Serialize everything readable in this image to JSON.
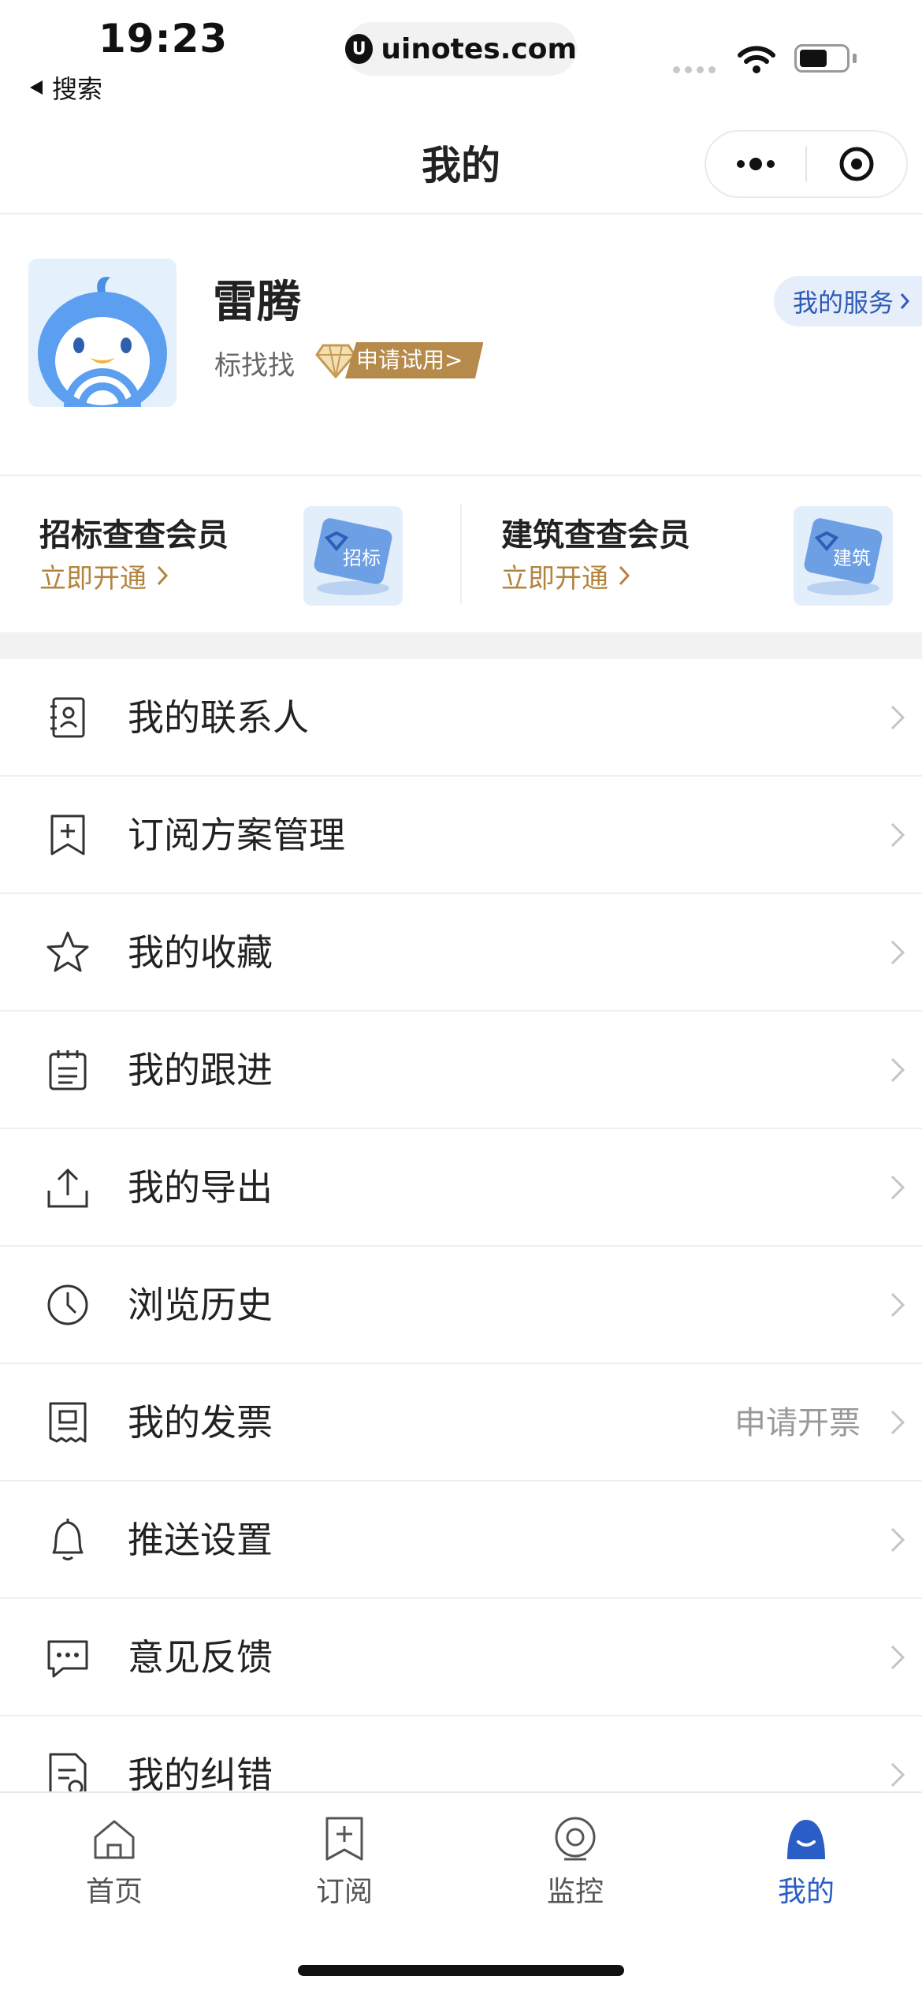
{
  "status_bar": {
    "time": "19:23",
    "back_label": "搜索",
    "url": "uinotes.com"
  },
  "nav": {
    "title": "我的"
  },
  "profile": {
    "name": "雷腾",
    "org": "标找找",
    "trial_label": "申请试用>",
    "service_label": "我的服务"
  },
  "members": [
    {
      "title": "招标查查会员",
      "link": "立即开通",
      "card_text": "招标"
    },
    {
      "title": "建筑查查会员",
      "link": "立即开通",
      "card_text": "建筑"
    }
  ],
  "menu": [
    {
      "label": "我的联系人",
      "icon": "contacts-icon"
    },
    {
      "label": "订阅方案管理",
      "icon": "bookmark-add-icon"
    },
    {
      "label": "我的收藏",
      "icon": "star-icon"
    },
    {
      "label": "我的跟进",
      "icon": "notepad-icon"
    },
    {
      "label": "我的导出",
      "icon": "upload-icon"
    },
    {
      "label": "浏览历史",
      "icon": "clock-icon"
    },
    {
      "label": "我的发票",
      "icon": "receipt-icon",
      "extra": "申请开票"
    },
    {
      "label": "推送设置",
      "icon": "bell-icon"
    },
    {
      "label": "意见反馈",
      "icon": "chat-icon"
    },
    {
      "label": "我的纠错",
      "icon": "document-check-icon"
    }
  ],
  "tabs": [
    {
      "label": "首页",
      "icon": "home-icon"
    },
    {
      "label": "订阅",
      "icon": "bookmark-add-icon"
    },
    {
      "label": "监控",
      "icon": "camera-icon"
    },
    {
      "label": "我的",
      "icon": "user-icon",
      "active": true
    }
  ],
  "colors": {
    "accent": "#2a5ec6",
    "gold": "#b3843e",
    "badge": "#b58a4a",
    "service_bg": "#e7eefb"
  }
}
